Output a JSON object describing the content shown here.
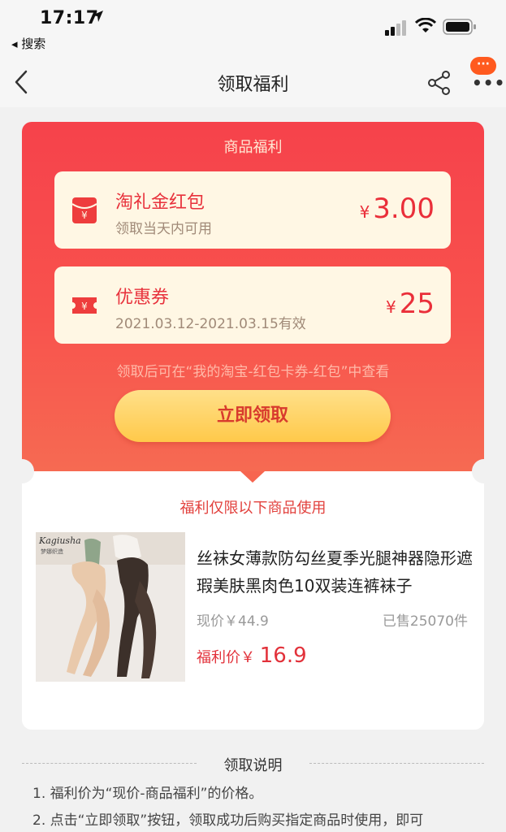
{
  "status_bar": {
    "time": "17:17",
    "back_app": "◂ 搜索"
  },
  "nav": {
    "title": "领取福利",
    "more_badge": "···"
  },
  "card": {
    "title": "商品福利",
    "benefits": [
      {
        "name": "淘礼金红包",
        "subtitle": "领取当天内可用",
        "currency": "¥",
        "amount": "3.00",
        "icon": "red-packet-icon"
      },
      {
        "name": "优惠券",
        "subtitle": "2021.03.12-2021.03.15有效",
        "currency": "¥",
        "amount": "25",
        "icon": "coupon-icon"
      }
    ],
    "note": "领取后可在“我的淘宝-红包卡券-红包”中查看",
    "claim_button": "立即领取"
  },
  "product": {
    "limit_text": "福利仅限以下商品使用",
    "name": "丝袜女薄款防勾丝夏季光腿神器隐形遮瑕美肤黑肉色10双装连裤袜子",
    "current_price": "现价￥44.9",
    "sold": "已售25070件",
    "welfare_price_label": "福利价",
    "welfare_price_currency": "￥",
    "welfare_price_value": "16.9",
    "image_brand": "Kagiusha",
    "image_brand_sub": "梦娜织造"
  },
  "instructions": {
    "title": "领取说明",
    "items": [
      "1. 福利价为“现价-商品福利”的价格。",
      "2. 点击“立即领取”按钮，领取成功后购买指定商品时使用，即可"
    ]
  },
  "colors": {
    "brand_red": "#f6424b",
    "amount_red": "#ea2f3a",
    "button_gold": "#ffc94a"
  }
}
